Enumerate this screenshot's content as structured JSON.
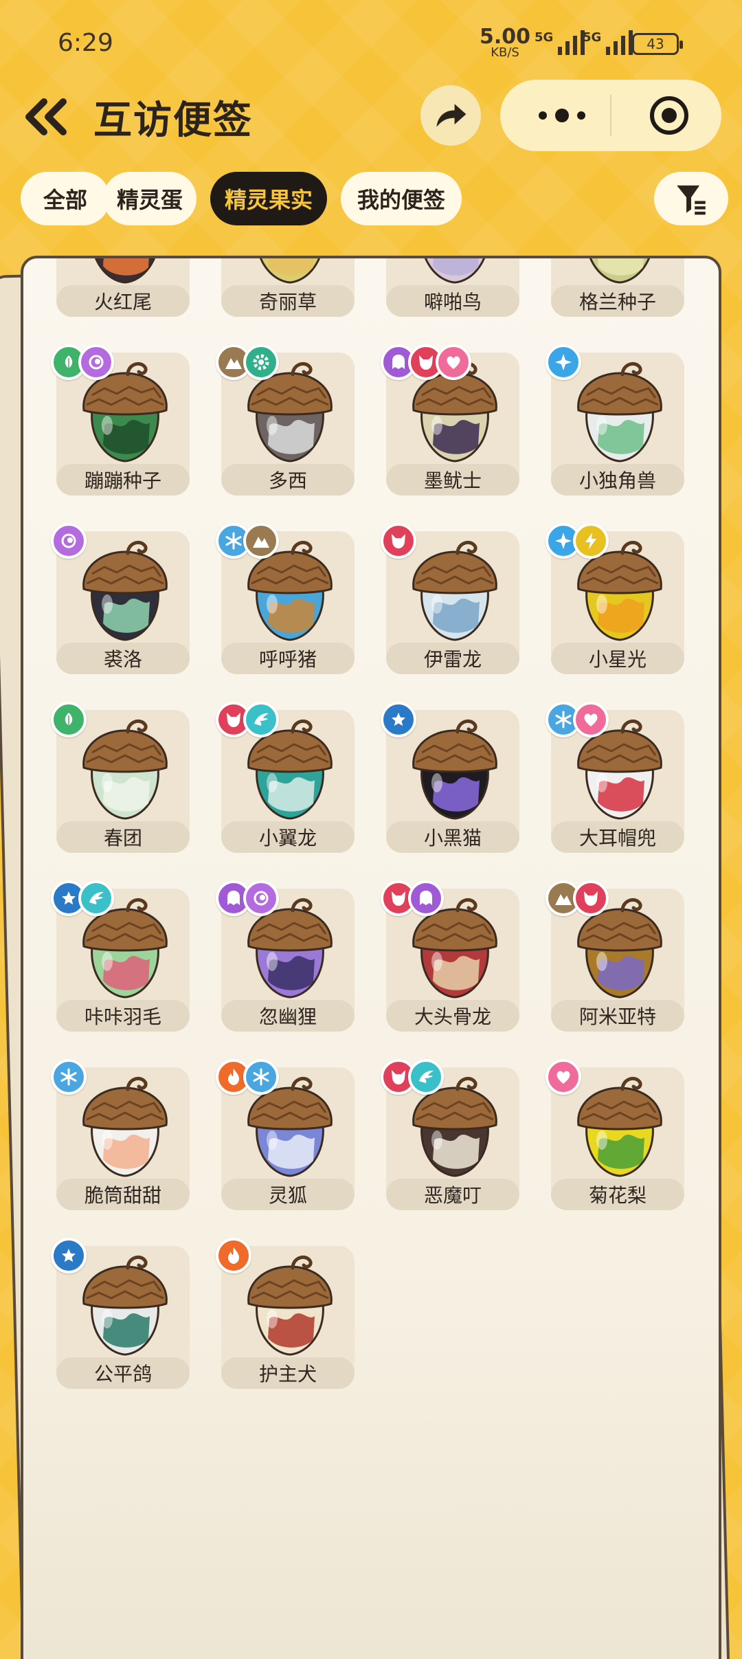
{
  "status_bar": {
    "time": "6:29",
    "net_speed": "5.00",
    "net_unit": "KB/S",
    "sig1_label": "5G",
    "sig2_label": "5G",
    "battery": "43"
  },
  "header": {
    "title": "互访便签"
  },
  "tabs": [
    {
      "label": "全部",
      "active": false
    },
    {
      "label": "精灵蛋",
      "active": false
    },
    {
      "label": "精灵果实",
      "active": true
    },
    {
      "label": "我的便签",
      "active": false
    }
  ],
  "colors": {
    "background": "#F7C339",
    "tab_active_bg": "#1F1A16",
    "tab_active_text": "#F8C53A"
  },
  "items": [
    {
      "name": "火红尾",
      "badges": [],
      "body": "#3b2d36",
      "accent": "#f07a3a"
    },
    {
      "name": "奇丽草",
      "badges": [],
      "body": "#d8d070",
      "accent": "#e8c060"
    },
    {
      "name": "噼啪鸟",
      "badges": [],
      "body": "#d9c7da",
      "accent": "#b8b0d8"
    },
    {
      "name": "格兰种子",
      "badges": [],
      "body": "#c9cf8a",
      "accent": "#e8e6b0"
    },
    {
      "name": "蹦蹦种子",
      "badges": [
        "grass-icon",
        "swirl-icon"
      ],
      "body": "#3d8a4e",
      "accent": "#1f4d2b"
    },
    {
      "name": "多西",
      "badges": [
        "mountain-icon",
        "gear-icon"
      ],
      "body": "#6e6464",
      "accent": "#dcdcdc"
    },
    {
      "name": "墨鱿士",
      "badges": [
        "ghost-icon",
        "demon-icon",
        "heart-icon"
      ],
      "body": "#d9d3b0",
      "accent": "#3a2a50"
    },
    {
      "name": "小独角兽",
      "badges": [
        "star4-icon"
      ],
      "body": "#e8ecea",
      "accent": "#6fc08a"
    },
    {
      "name": "裘洛",
      "badges": [
        "swirl-icon"
      ],
      "body": "#2e2f3a",
      "accent": "#8fd3b0"
    },
    {
      "name": "呼呼猪",
      "badges": [
        "snowflake-icon",
        "mountain-icon"
      ],
      "body": "#4aa6d8",
      "accent": "#c8863a"
    },
    {
      "name": "伊雷龙",
      "badges": [
        "demon-icon"
      ],
      "body": "#d6e4ec",
      "accent": "#7aa6c8"
    },
    {
      "name": "小星光",
      "badges": [
        "star4-icon",
        "bolt-icon"
      ],
      "body": "#e4c820",
      "accent": "#f0a020"
    },
    {
      "name": "春团",
      "badges": [
        "grass-icon"
      ],
      "body": "#cfe4cf",
      "accent": "#eef4ea"
    },
    {
      "name": "小翼龙",
      "badges": [
        "demon-icon",
        "wing-icon"
      ],
      "body": "#2ea39a",
      "accent": "#d8ece8"
    },
    {
      "name": "小黑猫",
      "badges": [
        "star-icon"
      ],
      "body": "#1e1c22",
      "accent": "#8a6ae0"
    },
    {
      "name": "大耳帽兜",
      "badges": [
        "snowflake-icon",
        "heart-icon"
      ],
      "body": "#f0f0f0",
      "accent": "#d63040"
    },
    {
      "name": "咔咔羽毛",
      "badges": [
        "star-icon",
        "wing-icon"
      ],
      "body": "#9cd49a",
      "accent": "#e0607a"
    },
    {
      "name": "忽幽狸",
      "badges": [
        "ghost-icon",
        "swirl-icon"
      ],
      "body": "#9a7ad6",
      "accent": "#3a2e66"
    },
    {
      "name": "大头骨龙",
      "badges": [
        "demon-icon",
        "ghost-icon"
      ],
      "body": "#b23a3a",
      "accent": "#e6d0a8"
    },
    {
      "name": "阿米亚特",
      "badges": [
        "mountain-icon",
        "demon-icon"
      ],
      "body": "#a87a2a",
      "accent": "#7a6ac8"
    },
    {
      "name": "脆筒甜甜",
      "badges": [
        "snowflake-icon"
      ],
      "body": "#f2f0ec",
      "accent": "#f4b090"
    },
    {
      "name": "灵狐",
      "badges": [
        "fire-icon",
        "snowflake-icon"
      ],
      "body": "#7a86d6",
      "accent": "#e8ecf8"
    },
    {
      "name": "恶魔叮",
      "badges": [
        "demon-icon",
        "wing-icon"
      ],
      "body": "#4a3630",
      "accent": "#f0e8d8"
    },
    {
      "name": "菊花梨",
      "badges": [
        "heart-icon"
      ],
      "body": "#e8d820",
      "accent": "#4aa03a"
    },
    {
      "name": "公平鸽",
      "badges": [
        "star-icon"
      ],
      "body": "#e8eaea",
      "accent": "#2a7a6a"
    },
    {
      "name": "护主犬",
      "badges": [
        "fire-icon"
      ],
      "body": "#f0e4cc",
      "accent": "#b03a2a"
    }
  ]
}
